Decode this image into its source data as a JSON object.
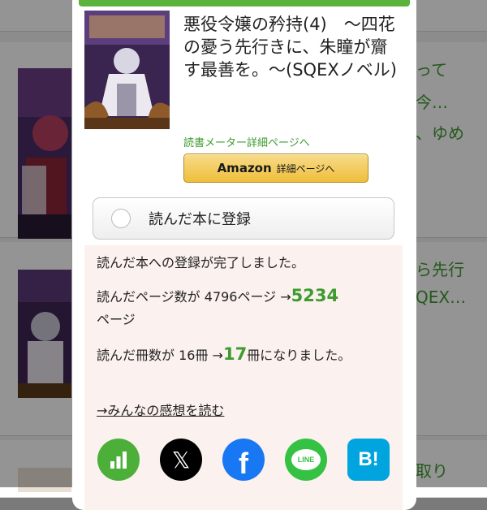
{
  "background": {
    "rows": [
      {
        "text_lines": [
          "って",
          "今…",
          "、ゆめ"
        ]
      },
      {
        "text_lines": [
          "ら先行",
          "QEX…"
        ]
      },
      {
        "text_lines": [
          "取り"
        ]
      }
    ]
  },
  "modal": {
    "book_title": "悪役令嬢の矜持(4)　～四花の憂う先行きに、朱瞳が齎す最善を。～(SQEXノベル)",
    "detail_link": "読書メーター詳細ページへ",
    "amazon_button": {
      "brand": "Amazon",
      "label": "詳細ページへ"
    },
    "register_button": "読んだ本に登録",
    "result": {
      "completed": "読んだ本への登録が完了しました。",
      "pages_prefix": "読んだページ数が 4796ページ →",
      "pages_new": "5234",
      "pages_suffix": "ページ",
      "books_prefix": "読んだ冊数が 16冊 →",
      "books_new": "17",
      "books_suffix": "冊になりました。",
      "feelings_link": "→みんなの感想を読む"
    },
    "share": [
      {
        "name": "bookmeter-icon",
        "color": "#4caf3a"
      },
      {
        "name": "x-icon",
        "color": "#000000",
        "glyph": "𝕏"
      },
      {
        "name": "facebook-icon",
        "color": "#1877f2",
        "glyph": "f"
      },
      {
        "name": "line-icon",
        "color": "#35c244",
        "glyph": "LINE"
      },
      {
        "name": "hatena-bookmark-icon",
        "color": "#00a4de",
        "glyph": "B!"
      }
    ]
  }
}
